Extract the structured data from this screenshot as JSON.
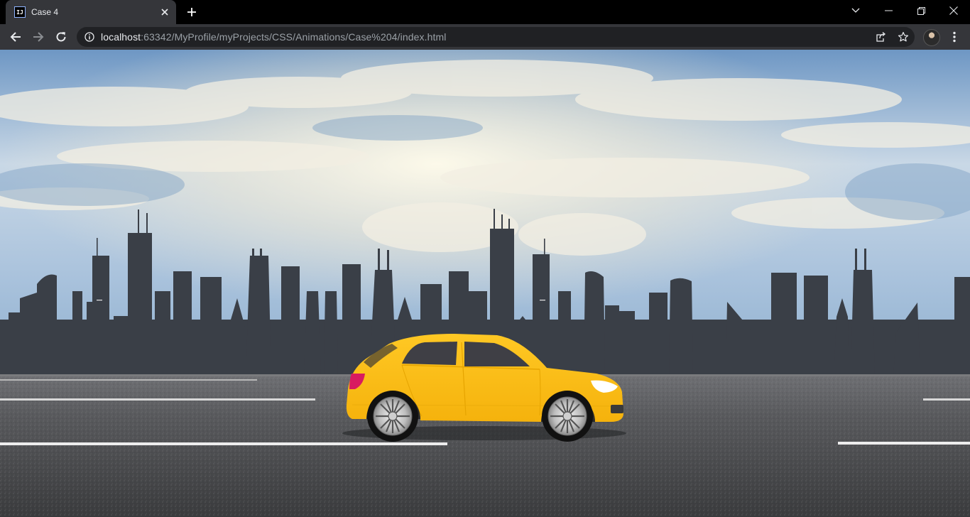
{
  "browser": {
    "tab": {
      "title": "Case 4",
      "favicon_text": "IJ",
      "favicon_icon": "intellij-icon"
    },
    "address_bar": {
      "host": "localhost",
      "path": ":63342/MyProfile/myProjects/CSS/Animations/Case%204/index.html"
    },
    "icons": {
      "back": "arrow-left-icon",
      "forward": "arrow-right-icon",
      "reload": "reload-icon",
      "info": "info-icon",
      "share": "share-icon",
      "bookmark": "star-icon",
      "menu": "kebab-menu-icon",
      "tab_search": "chevron-down-icon",
      "minimize": "minimize-icon",
      "restore": "restore-icon",
      "close": "close-icon",
      "new_tab": "plus-icon"
    },
    "colors": {
      "tabstrip": "#000000",
      "toolbar": "#35363a",
      "omnibox": "#202124"
    }
  },
  "scene": {
    "description_icons": [
      "sky",
      "city-skyline",
      "road",
      "yellow-car"
    ],
    "colors": {
      "car_body": "#ffc21a",
      "car_window": "#3f3f45",
      "skyline": "#3a3f47",
      "road": "#4a4b4e",
      "sky_top": "#5f8fbf",
      "sky_light": "#f4f1e6"
    }
  }
}
